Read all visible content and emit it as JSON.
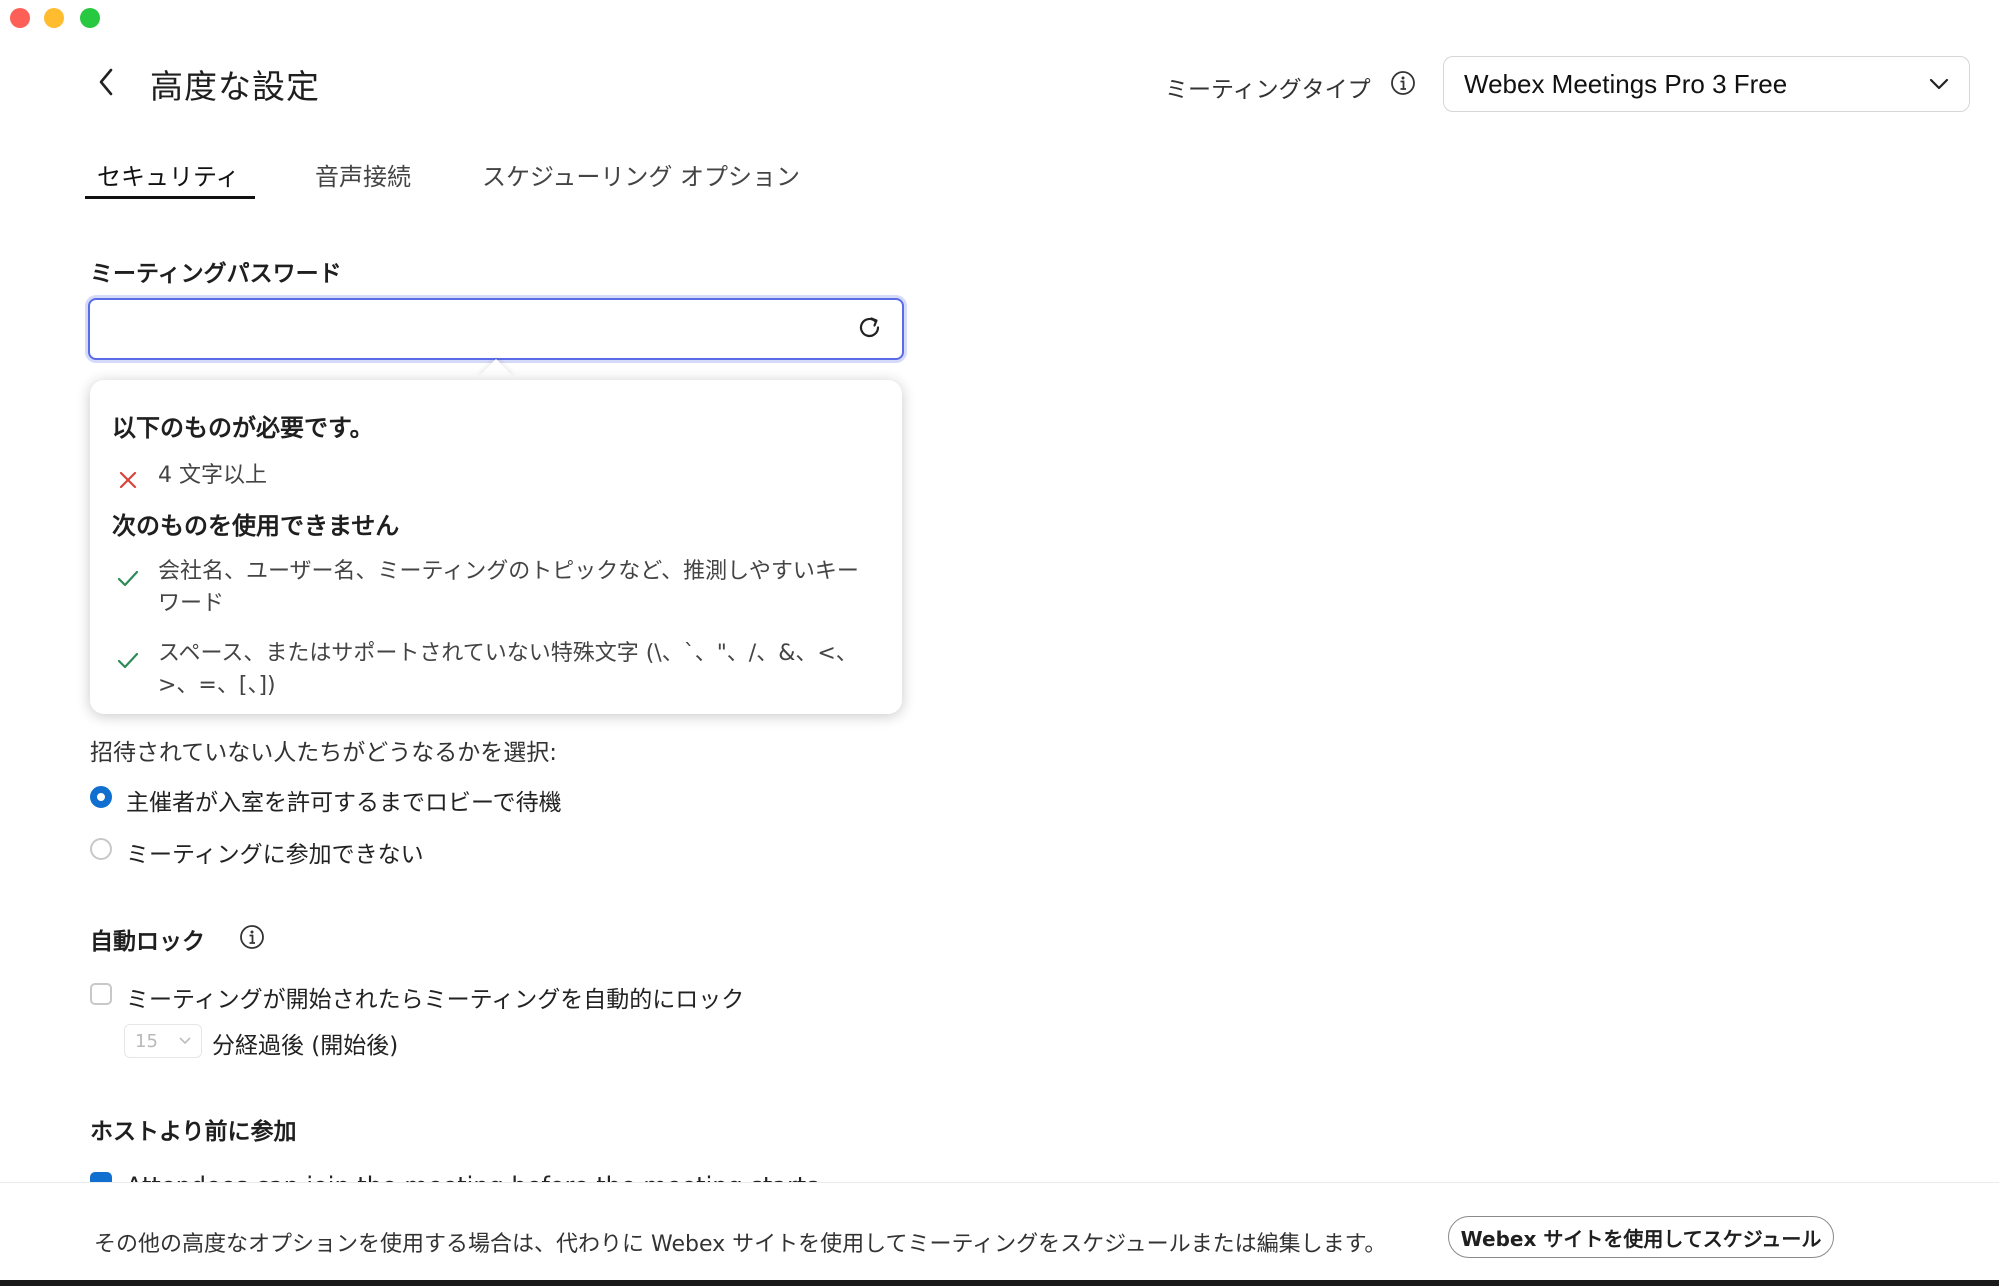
{
  "header": {
    "title": "高度な設定",
    "meeting_type_label": "ミーティングタイプ",
    "meeting_type_value": "Webex Meetings Pro 3 Free"
  },
  "tabs": [
    {
      "label": "セキュリティ",
      "active": true
    },
    {
      "label": "音声接続",
      "active": false
    },
    {
      "label": "スケジューリング オプション",
      "active": false
    }
  ],
  "password": {
    "heading": "ミーティングパスワード",
    "value": ""
  },
  "popover": {
    "required_heading": "以下のものが必要です。",
    "required_items": [
      "4 文字以上"
    ],
    "forbidden_heading": "次のものを使用できません",
    "forbidden_items": [
      [
        "会社名、ユーザー名、ミーティングのトピックなど、推測しやすいキー",
        "ワード"
      ],
      [
        "スペース、またはサポートされていない特殊文字 (\\、`、\"、/、&、<、",
        ">、=、[、])"
      ]
    ]
  },
  "uninvited": {
    "question": "招待されていない人たちがどうなるかを選択:",
    "options": [
      {
        "label": "主催者が入室を許可するまでロビーで待機",
        "selected": true
      },
      {
        "label": "ミーティングに参加できない",
        "selected": false
      }
    ]
  },
  "auto_lock": {
    "heading": "自動ロック",
    "checkbox_label": "ミーティングが開始されたらミーティングを自動的にロック",
    "checked": false,
    "minutes_value": "15",
    "minutes_suffix": "分経過後 (開始後)"
  },
  "join_before_host": {
    "heading": "ホストより前に参加",
    "checkbox_label": "Attendees can join the meeting before the meeting starts",
    "checked": true
  },
  "footer": {
    "text": "その他の高度なオプションを使用する場合は、代わりに Webex サイトを使用してミーティングをスケジュールまたは編集します。",
    "button_label": "Webex サイトを使用してスケジュール"
  },
  "colors": {
    "accent": "#1170cf",
    "focus_border": "#5a6be8",
    "error_x": "#d9443a",
    "ok_check": "#2e8b57"
  }
}
